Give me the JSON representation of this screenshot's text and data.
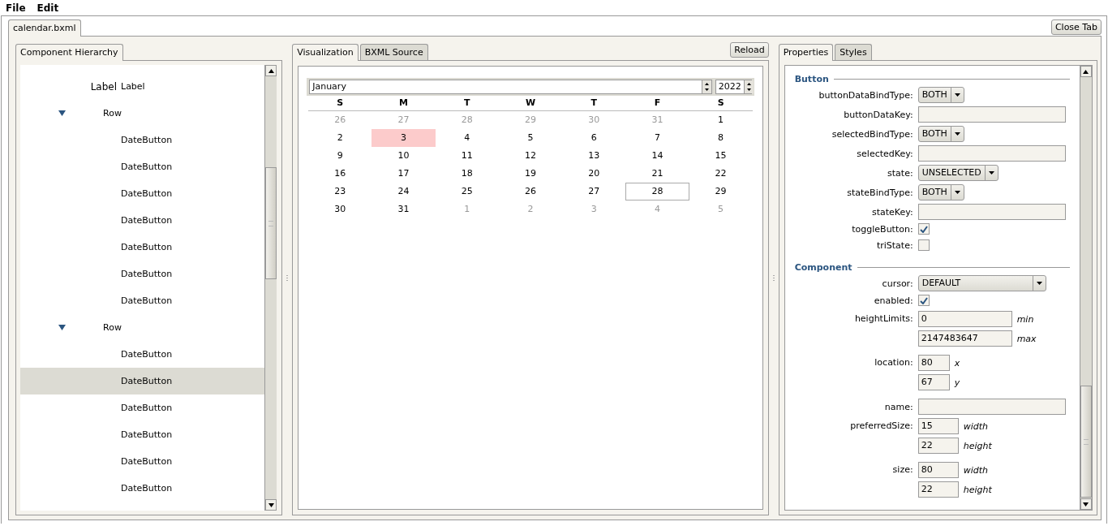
{
  "menu": [
    {
      "label": "File"
    },
    {
      "label": "Edit"
    }
  ],
  "document_tabs": [
    {
      "label": "calendar.bxml",
      "selected": true
    }
  ],
  "close_tab_button": "Close Tab",
  "hierarchy": {
    "tabs": [
      {
        "label": "Component Hierarchy",
        "selected": true
      }
    ],
    "tree": [
      {
        "kind": "leaf",
        "icon_text": "Label",
        "label": "Label",
        "selected": false
      },
      {
        "kind": "branch",
        "label": "Row",
        "expanded": true,
        "selected": false,
        "children": [
          {
            "kind": "leaf",
            "label": "DateButton",
            "selected": false
          },
          {
            "kind": "leaf",
            "label": "DateButton",
            "selected": false
          },
          {
            "kind": "leaf",
            "label": "DateButton",
            "selected": false
          },
          {
            "kind": "leaf",
            "label": "DateButton",
            "selected": false
          },
          {
            "kind": "leaf",
            "label": "DateButton",
            "selected": false
          },
          {
            "kind": "leaf",
            "label": "DateButton",
            "selected": false
          },
          {
            "kind": "leaf",
            "label": "DateButton",
            "selected": false
          }
        ]
      },
      {
        "kind": "branch",
        "label": "Row",
        "expanded": true,
        "selected": false,
        "children": [
          {
            "kind": "leaf",
            "label": "DateButton",
            "selected": false
          },
          {
            "kind": "leaf",
            "label": "DateButton",
            "selected": true
          },
          {
            "kind": "leaf",
            "label": "DateButton",
            "selected": false
          },
          {
            "kind": "leaf",
            "label": "DateButton",
            "selected": false
          },
          {
            "kind": "leaf",
            "label": "DateButton",
            "selected": false
          },
          {
            "kind": "leaf",
            "label": "DateButton",
            "selected": false
          }
        ]
      }
    ]
  },
  "preview": {
    "tabs": [
      {
        "label": "Visualization",
        "selected": true
      },
      {
        "label": "BXML Source",
        "selected": false
      }
    ],
    "reload_button": "Reload",
    "calendar": {
      "month": "January",
      "year": "2022",
      "weekdays": [
        "S",
        "M",
        "T",
        "W",
        "T",
        "F",
        "S"
      ],
      "weeks": [
        [
          {
            "text": "26",
            "in_month": false,
            "selected": false,
            "today": false
          },
          {
            "text": "27",
            "in_month": false,
            "selected": false,
            "today": false
          },
          {
            "text": "28",
            "in_month": false,
            "selected": false,
            "today": false
          },
          {
            "text": "29",
            "in_month": false,
            "selected": false,
            "today": false
          },
          {
            "text": "30",
            "in_month": false,
            "selected": false,
            "today": false
          },
          {
            "text": "31",
            "in_month": false,
            "selected": false,
            "today": false
          },
          {
            "text": "1",
            "in_month": true,
            "selected": false,
            "today": false
          }
        ],
        [
          {
            "text": "2",
            "in_month": true,
            "selected": false,
            "today": false
          },
          {
            "text": "3",
            "in_month": true,
            "selected": true,
            "today": false
          },
          {
            "text": "4",
            "in_month": true,
            "selected": false,
            "today": false
          },
          {
            "text": "5",
            "in_month": true,
            "selected": false,
            "today": false
          },
          {
            "text": "6",
            "in_month": true,
            "selected": false,
            "today": false
          },
          {
            "text": "7",
            "in_month": true,
            "selected": false,
            "today": false
          },
          {
            "text": "8",
            "in_month": true,
            "selected": false,
            "today": false
          }
        ],
        [
          {
            "text": "9",
            "in_month": true,
            "selected": false,
            "today": false
          },
          {
            "text": "10",
            "in_month": true,
            "selected": false,
            "today": false
          },
          {
            "text": "11",
            "in_month": true,
            "selected": false,
            "today": false
          },
          {
            "text": "12",
            "in_month": true,
            "selected": false,
            "today": false
          },
          {
            "text": "13",
            "in_month": true,
            "selected": false,
            "today": false
          },
          {
            "text": "14",
            "in_month": true,
            "selected": false,
            "today": false
          },
          {
            "text": "15",
            "in_month": true,
            "selected": false,
            "today": false
          }
        ],
        [
          {
            "text": "16",
            "in_month": true,
            "selected": false,
            "today": false
          },
          {
            "text": "17",
            "in_month": true,
            "selected": false,
            "today": false
          },
          {
            "text": "18",
            "in_month": true,
            "selected": false,
            "today": false
          },
          {
            "text": "19",
            "in_month": true,
            "selected": false,
            "today": false
          },
          {
            "text": "20",
            "in_month": true,
            "selected": false,
            "today": false
          },
          {
            "text": "21",
            "in_month": true,
            "selected": false,
            "today": false
          },
          {
            "text": "22",
            "in_month": true,
            "selected": false,
            "today": false
          }
        ],
        [
          {
            "text": "23",
            "in_month": true,
            "selected": false,
            "today": false
          },
          {
            "text": "24",
            "in_month": true,
            "selected": false,
            "today": false
          },
          {
            "text": "25",
            "in_month": true,
            "selected": false,
            "today": false
          },
          {
            "text": "26",
            "in_month": true,
            "selected": false,
            "today": false
          },
          {
            "text": "27",
            "in_month": true,
            "selected": false,
            "today": false
          },
          {
            "text": "28",
            "in_month": true,
            "selected": false,
            "today": true
          },
          {
            "text": "29",
            "in_month": true,
            "selected": false,
            "today": false
          }
        ],
        [
          {
            "text": "30",
            "in_month": true,
            "selected": false,
            "today": false
          },
          {
            "text": "31",
            "in_month": true,
            "selected": false,
            "today": false
          },
          {
            "text": "1",
            "in_month": false,
            "selected": false,
            "today": false
          },
          {
            "text": "2",
            "in_month": false,
            "selected": false,
            "today": false
          },
          {
            "text": "3",
            "in_month": false,
            "selected": false,
            "today": false
          },
          {
            "text": "4",
            "in_month": false,
            "selected": false,
            "today": false
          },
          {
            "text": "5",
            "in_month": false,
            "selected": false,
            "today": false
          }
        ]
      ]
    }
  },
  "inspector": {
    "tabs": [
      {
        "label": "Properties",
        "selected": true
      },
      {
        "label": "Styles",
        "selected": false
      }
    ],
    "sections": [
      {
        "title": "Button",
        "rows": [
          {
            "kind": "dropdown",
            "label": "buttonDataBindType:",
            "value": "BOTH"
          },
          {
            "kind": "text",
            "label": "buttonDataKey:"
          },
          {
            "kind": "dropdown",
            "label": "selectedBindType:",
            "value": "BOTH"
          },
          {
            "kind": "text",
            "label": "selectedKey:"
          },
          {
            "kind": "dropdown",
            "label": "state:",
            "value": "UNSELECTED"
          },
          {
            "kind": "dropdown",
            "label": "stateBindType:",
            "value": "BOTH"
          },
          {
            "kind": "text",
            "label": "stateKey:"
          },
          {
            "kind": "checkbox",
            "label": "toggleButton:",
            "checked": true
          },
          {
            "kind": "checkbox",
            "label": "triState:",
            "checked": false
          }
        ]
      },
      {
        "title": "Component",
        "rows": [
          {
            "kind": "dropdown",
            "label": "cursor:",
            "value": "DEFAULT"
          },
          {
            "kind": "checkbox",
            "label": "enabled:",
            "checked": true
          },
          {
            "kind": "pair",
            "label": "heightLimits:",
            "fields": [
              {
                "value": "0",
                "unit": "min"
              },
              {
                "value": "2147483647",
                "unit": "max"
              }
            ]
          },
          {
            "kind": "pair",
            "label": "location:",
            "fields": [
              {
                "value": "80",
                "unit": "x"
              },
              {
                "value": "67",
                "unit": "y"
              }
            ]
          },
          {
            "kind": "text",
            "label": "name:"
          },
          {
            "kind": "pair",
            "label": "preferredSize:",
            "fields": [
              {
                "value": "15",
                "unit": "width"
              },
              {
                "value": "22",
                "unit": "height"
              }
            ]
          },
          {
            "kind": "pair",
            "label": "size:",
            "fields": [
              {
                "value": "80",
                "unit": "width"
              },
              {
                "value": "22",
                "unit": "height"
              }
            ]
          }
        ]
      }
    ]
  }
}
